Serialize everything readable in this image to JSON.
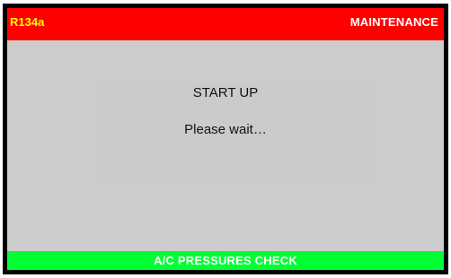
{
  "header": {
    "refrigerant": "R134a",
    "mode": "MAINTENANCE"
  },
  "main": {
    "title": "START UP",
    "message": "Please wait…"
  },
  "footer": {
    "label": "A/C PRESSURES CHECK"
  },
  "colors": {
    "header_bg": "#ff0000",
    "refrigerant_text": "#ffff00",
    "main_bg": "#cccccc",
    "footer_bg": "#00ff33",
    "frame": "#000000"
  }
}
